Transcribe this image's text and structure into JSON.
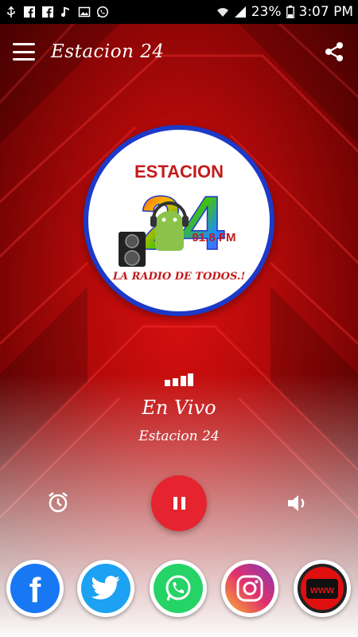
{
  "status_bar": {
    "battery_percent": "23%",
    "time": "3:07 PM",
    "icons": [
      "usb-icon",
      "facebook-notif-icon",
      "facebook-notif-icon",
      "music-notif-icon",
      "image-notif-icon",
      "whatsapp-notif-icon",
      "wifi-icon",
      "signal-icon",
      "battery-icon"
    ]
  },
  "toolbar": {
    "title": "Estacion 24",
    "menu_icon": "hamburger-menu-icon",
    "share_icon": "share-icon"
  },
  "logo": {
    "brand": "ESTACION",
    "number": "24",
    "frequency": "91.8 FM",
    "slogan": "LA RADIO DE TODOS.!",
    "border_color": "#1d39c8"
  },
  "now_playing": {
    "title": "En Vivo",
    "station": "Estacion 24",
    "signal_icon": "signal-bars-icon"
  },
  "controls": {
    "alarm_icon": "alarm-clock-icon",
    "play_state_icon": "pause-icon",
    "volume_icon": "volume-icon",
    "accent_color": "#e5242f"
  },
  "social_links": [
    {
      "name": "facebook",
      "icon": "facebook-icon",
      "color": "#1877f2",
      "label": "f"
    },
    {
      "name": "twitter",
      "icon": "twitter-icon",
      "color": "#1da1f2"
    },
    {
      "name": "whatsapp",
      "icon": "whatsapp-icon",
      "color": "#25d366"
    },
    {
      "name": "instagram",
      "icon": "instagram-icon",
      "color": "#d6249f"
    },
    {
      "name": "website",
      "icon": "website-icon",
      "color": "#e01010",
      "label": "www"
    }
  ]
}
